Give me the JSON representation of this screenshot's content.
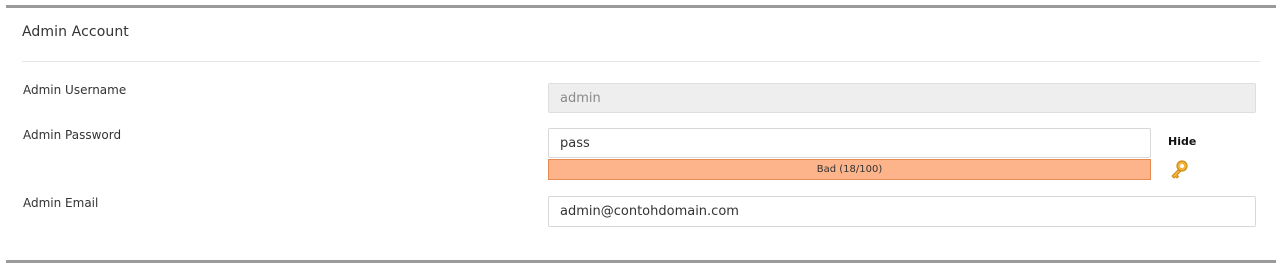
{
  "section": {
    "title": "Admin Account"
  },
  "fields": {
    "username": {
      "label": "Admin Username",
      "value": "admin"
    },
    "password": {
      "label": "Admin Password",
      "value": "pass",
      "toggle_label": "Hide",
      "strength_text": "Bad (18/100)",
      "strength_value": 100,
      "strength_color": "#fdb48a",
      "strength_border_color": "#e58a52"
    },
    "email": {
      "label": "Admin Email",
      "value": "admin@contohdomain.com"
    }
  },
  "icons": {
    "generate_password": "key-icon"
  }
}
